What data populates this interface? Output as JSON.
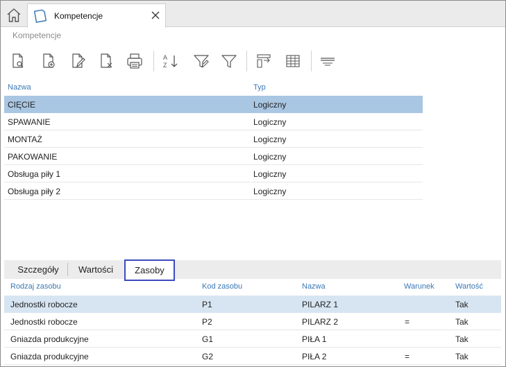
{
  "tab": {
    "title": "Kompetencje"
  },
  "breadcrumb": "Kompetencje",
  "toolbar": {
    "buttons": [
      "preview-icon",
      "add-icon",
      "edit-icon",
      "delete-icon",
      "print-icon",
      "sort-az-icon",
      "filter-edit-icon",
      "filter-icon",
      "column-settings-icon",
      "grid-icon",
      "group-bar-icon"
    ]
  },
  "main_grid": {
    "columns": [
      "Nazwa",
      "Typ"
    ],
    "rows": [
      {
        "name": "CIĘCIE",
        "type": "Logiczny",
        "selected": true
      },
      {
        "name": "SPAWANIE",
        "type": "Logiczny"
      },
      {
        "name": "MONTAŻ",
        "type": "Logiczny"
      },
      {
        "name": "PAKOWANIE",
        "type": "Logiczny"
      },
      {
        "name": "Obsługa piły 1",
        "type": "Logiczny"
      },
      {
        "name": "Obsługa piły 2",
        "type": "Logiczny"
      }
    ]
  },
  "bottom_tabs": [
    "Szczegóły",
    "Wartości",
    "Zasoby"
  ],
  "bottom_active_tab": "Zasoby",
  "resource_grid": {
    "columns": [
      "Rodzaj zasobu",
      "Kod zasobu",
      "Nazwa",
      "Warunek",
      "Wartość"
    ],
    "rows": [
      {
        "kind": "Jednostki robocze",
        "code": "P1",
        "name": "PILARZ 1",
        "cond": "",
        "value": "Tak",
        "selected": true
      },
      {
        "kind": "Jednostki robocze",
        "code": "P2",
        "name": "PILARZ 2",
        "cond": "=",
        "value": "Tak"
      },
      {
        "kind": "Gniazda produkcyjne",
        "code": "G1",
        "name": "PIŁA 1",
        "cond": "",
        "value": "Tak"
      },
      {
        "kind": "Gniazda produkcyjne",
        "code": "G2",
        "name": "PIŁA 2",
        "cond": "=",
        "value": "Tak"
      }
    ]
  },
  "colors": {
    "accent": "#3a78b5",
    "selection": "#a9c6e2",
    "active_tab_border": "#3b4bbf"
  }
}
